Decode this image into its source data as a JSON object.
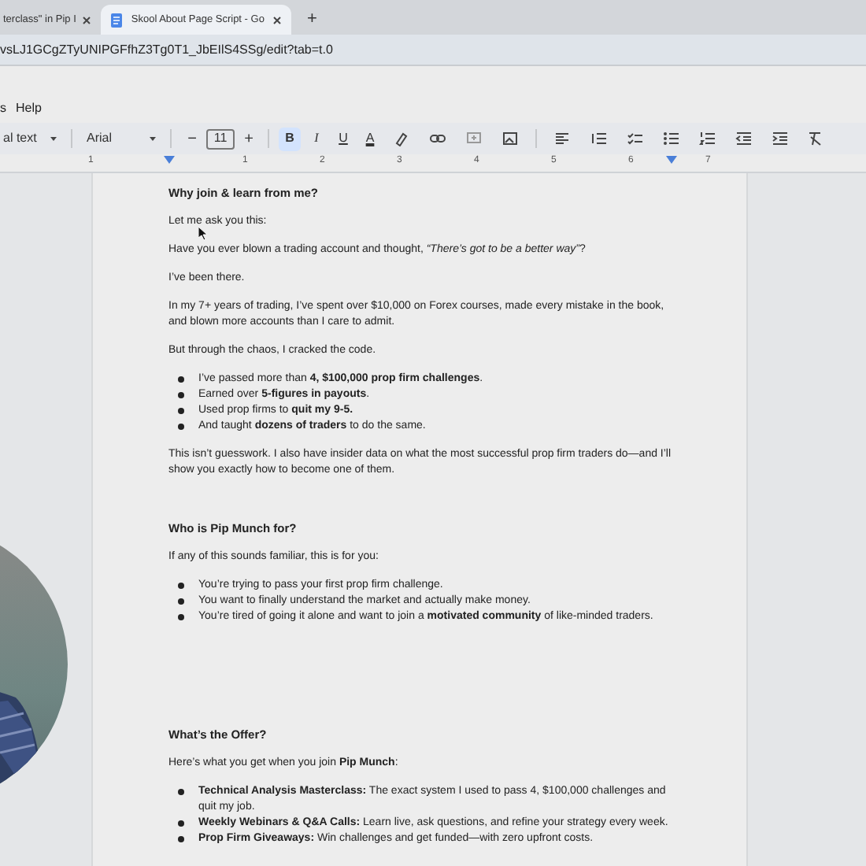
{
  "browser": {
    "tabs": [
      {
        "title": "terclass\" in Pip I",
        "selected": false
      },
      {
        "title": "Skool About Page Script - Go",
        "selected": true
      }
    ],
    "new_tab": "+",
    "address": "vsLJ1GCgZTyUNIPGFfhZ3Tg0T1_JbEIlS4SSg/edit?tab=t.0"
  },
  "menu": [
    "s",
    "Help"
  ],
  "toolbar": {
    "style": "al text",
    "font": "Arial",
    "decrease": "−",
    "size": "11",
    "increase": "+",
    "format_buttons": [
      {
        "label": "B",
        "selected": true
      },
      {
        "label": "I",
        "selected": false
      },
      {
        "label": "U",
        "selected": false
      },
      {
        "label": "A",
        "selected": false
      }
    ]
  },
  "ruler": [
    "1",
    "1",
    "2",
    "3",
    "4",
    "5",
    "6",
    "7"
  ],
  "document": [
    {
      "kind": "heading",
      "text": "Why join & learn from me?"
    },
    {
      "kind": "paragraph",
      "text": "Let me ask you this:"
    },
    {
      "kind": "paragraph",
      "text": "Have you ever blown a trading account and thought, *“There’s got to be a better way”*?"
    },
    {
      "kind": "paragraph",
      "text": "I’ve been there."
    },
    {
      "kind": "paragraph",
      "text": "In my 7+ years of trading, I’ve spent over $10,000 on Forex courses, made every mistake in the book, and blown more accounts than I care to admit."
    },
    {
      "kind": "paragraph",
      "text": "But through the chaos, I cracked the code."
    },
    {
      "kind": "bullets",
      "items": [
        "I’ve passed more than **4, $100,000 prop firm challenges**.",
        "Earned over **5-figures in payouts**.",
        "Used prop firms to **quit my 9-5.**",
        "And taught **dozens of traders** to do the same."
      ]
    },
    {
      "kind": "paragraph",
      "text": "This isn’t guesswork. I also have insider data on what the most successful prop firm traders do—and I’ll show you exactly how to become one of them."
    },
    {
      "kind": "blank"
    },
    {
      "kind": "heading",
      "text": "Who is Pip Munch for?"
    },
    {
      "kind": "paragraph",
      "text": "If any of this sounds familiar, this is for you:"
    },
    {
      "kind": "bullets",
      "items": [
        "You’re trying to pass your first prop firm challenge.",
        "You want to finally understand the market and actually make money.",
        "You’re tired of going it alone and want to join a **motivated community** of like-minded traders."
      ]
    },
    {
      "kind": "blank"
    },
    {
      "kind": "blank"
    },
    {
      "kind": "blank"
    },
    {
      "kind": "heading",
      "text": "What’s the Offer?"
    },
    {
      "kind": "paragraph",
      "text": "Here’s what you get when you join **Pip Munch**:"
    },
    {
      "kind": "bullets",
      "items": [
        "**Technical Analysis Masterclass:** The exact system I used to pass 4, $100,000 challenges and quit my job.",
        "**Weekly Webinars & Q&A Calls:** Learn live, ask questions, and refine your strategy every week.",
        "**Prop Firm Giveaways:** Win challenges and get funded—with zero upfront costs."
      ]
    }
  ]
}
